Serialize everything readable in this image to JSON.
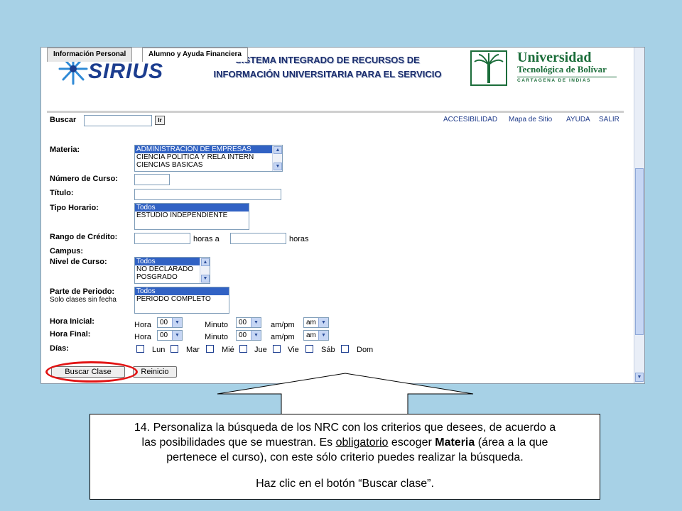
{
  "banner": {
    "logo_text": "SIRIUS",
    "title_line1": "SISTEMA INTEGRADO DE RECURSOS DE",
    "title_line2": "INFORMACIÓN UNIVERSITARIA PARA EL SERVICIO",
    "university_name": "Universidad",
    "university_sub": "Tecnológica de Bolívar",
    "university_city": "CARTAGENA DE INDIAS"
  },
  "tabs": [
    {
      "label": "Información Personal"
    },
    {
      "label": "Alumno y Ayuda Financiera"
    }
  ],
  "search": {
    "label": "Buscar",
    "value": "",
    "go_label": "Ir"
  },
  "top_links": [
    "ACCESIBILIDAD",
    "Mapa de Sitio",
    "AYUDA",
    "SALIR"
  ],
  "form": {
    "materia_label": "Materia:",
    "materia_options": [
      "ADMINISTRACIÓN DE EMPRESAS",
      "CIENCIA POLITICA Y RELA INTERN",
      "CIENCIAS BASICAS"
    ],
    "numero_curso_label": "Número de Curso:",
    "titulo_label": "Título:",
    "tipo_horario_label": "Tipo Horario:",
    "tipo_horario_options": [
      "Todos",
      "ESTUDIO INDEPENDIENTE"
    ],
    "rango_credito_label": "Rango de Crédito:",
    "horas_a": "horas a",
    "horas": "horas",
    "campus_label": "Campus:",
    "nivel_curso_label": "Nivel de Curso:",
    "nivel_curso_options": [
      "Todos",
      "NO DECLARADO",
      "POSGRADO"
    ],
    "parte_periodo_label": "Parte de Periodo:",
    "solo_clases": "Solo clases sin fecha",
    "parte_periodo_options": [
      "Todos",
      "PERIODO COMPLETO"
    ],
    "hora_inicial_label": "Hora Inicial:",
    "hora_final_label": "Hora Final:",
    "hora": "Hora",
    "minuto": "Minuto",
    "ampm": "am/pm",
    "hora_value": "00",
    "minuto_value": "00",
    "ampm_value": "am",
    "dias_label": "Días:",
    "dias": [
      "Lun",
      "Mar",
      "Mié",
      "Jue",
      "Vie",
      "Sáb",
      "Dom"
    ],
    "buscar_clase_button": "Buscar Clase",
    "reinicio_button": "Reinicio"
  },
  "callout": {
    "line1": "14. Personaliza la búsqueda de los NRC con los criterios que desees, de acuerdo a",
    "line2_a": "las posibilidades que se muestran.  Es ",
    "line2_u": "obligatorio",
    "line2_b": " escoger ",
    "line2_bold": "Materia",
    "line2_c": " (área a la que",
    "line3": "pertenece el curso), con este sólo criterio puedes realizar la búsqueda.",
    "line4": "Haz clic en el botón “Buscar clase”."
  },
  "colors": {
    "background": "#a7d1e6",
    "selection": "#3162c4",
    "highlight_ellipse": "#e21414",
    "brand_blue": "#1c3d8f",
    "university_green": "#1b6d3a"
  }
}
